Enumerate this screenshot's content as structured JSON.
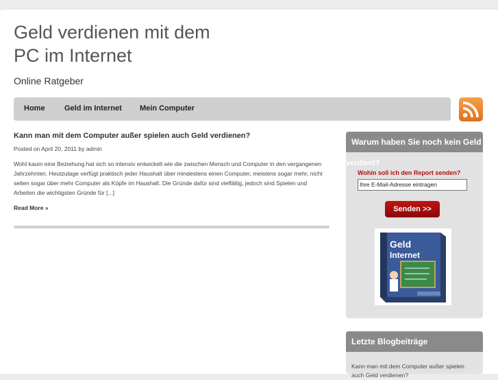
{
  "site": {
    "title_line1": "Geld verdienen mit dem",
    "title_line2": "PC im Internet",
    "tagline": "Online Ratgeber"
  },
  "nav": {
    "items": [
      {
        "label": "Home"
      },
      {
        "label": "Geld im Internet"
      },
      {
        "label": "Mein Computer"
      }
    ]
  },
  "icons": {
    "feed": "rss-feed-icon"
  },
  "post": {
    "title": "Kann man mit dem Computer außer spielen auch Geld verdienen?",
    "meta": "Posted on April 20, 2011 by admin",
    "excerpt": "Wohl kaum eine Beziehung hat sich so intensiv entwickelt wie die zwischen Mensch und Computer in den vergangenen Jahrzehnten. Heutzutage verfügt praktisch jeder Haushalt über mindestens einen Computer, meistens sogar mehr, nicht selten sogar über mehr Computer als Köpfe im Haushalt. Die Gründe dafür sind vielfältig, jedoch sind Spielen und Arbeiten die wichtigsten Gründe für [...]",
    "read_more": "Read More »"
  },
  "sidebar": {
    "box1": {
      "title": "Warum haben Sie noch kein Geld",
      "title_overflow": "verdient?",
      "report_label": "Wohin soll ich den Report senden?",
      "email_placeholder": "Ihre E-Mail-Adresse eintragen",
      "send_label": "Senden >>",
      "book_title_1": "Geld",
      "book_title_2": "Internet"
    },
    "box2": {
      "title": "Letzte Blogbeiträge",
      "items": [
        {
          "label": "Kann man mit dem Computer außer spielen auch Geld verdienen?"
        }
      ]
    }
  },
  "colors": {
    "nav_bg": "#cfcfcf",
    "sidebar_head": "#8a8a8a",
    "send_button": "#b01010",
    "rss": "#f08a2c"
  }
}
